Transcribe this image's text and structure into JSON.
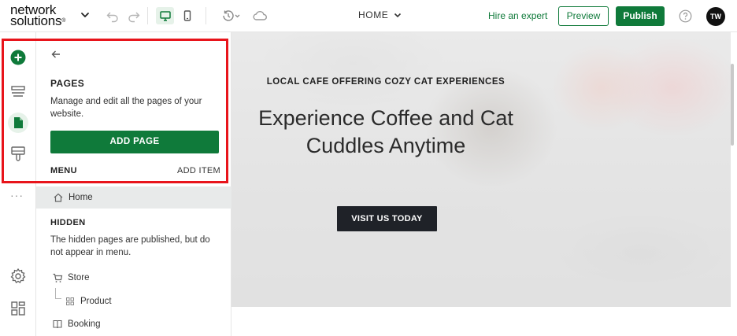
{
  "brand": {
    "line1": "network",
    "line2": "solutions",
    "trademark": "®"
  },
  "toolbar": {
    "page_selector": "HOME",
    "hire_link": "Hire an expert",
    "preview_label": "Preview",
    "publish_label": "Publish",
    "avatar_initials": "TW",
    "icons": [
      "chevron-down-icon",
      "undo-icon",
      "redo-icon",
      "desktop-icon",
      "mobile-icon",
      "history-icon",
      "cloud-icon",
      "help-icon"
    ]
  },
  "rail": {
    "icons": [
      "add-circle-icon",
      "sections-icon",
      "pages-icon",
      "theme-brush-icon",
      "more-icon",
      "settings-icon",
      "apps-icon"
    ],
    "more_label": "···"
  },
  "pages_panel": {
    "title": "PAGES",
    "description": "Manage and edit all the pages of your website.",
    "add_page_label": "ADD PAGE",
    "menu_label": "MENU",
    "add_item_label": "ADD ITEM",
    "menu_items": [
      {
        "label": "Home",
        "icon": "home-icon",
        "active": true
      }
    ],
    "hidden_label": "HIDDEN",
    "hidden_description": "The hidden pages are published, but do not appear in menu.",
    "hidden_items": [
      {
        "label": "Store",
        "icon": "cart-icon"
      },
      {
        "label": "Product",
        "icon": "grid-icon",
        "child": true
      },
      {
        "label": "Booking",
        "icon": "book-icon"
      }
    ]
  },
  "hero": {
    "kicker": "LOCAL CAFE OFFERING COZY CAT EXPERIENCES",
    "title_line1": "Experience Coffee and Cat",
    "title_line2": "Cuddles Anytime",
    "cta_label": "VISIT US TODAY"
  },
  "colors": {
    "brand_green": "#0f7a3a",
    "highlight_red": "#e8141b",
    "cta_dark": "#1f2228"
  }
}
